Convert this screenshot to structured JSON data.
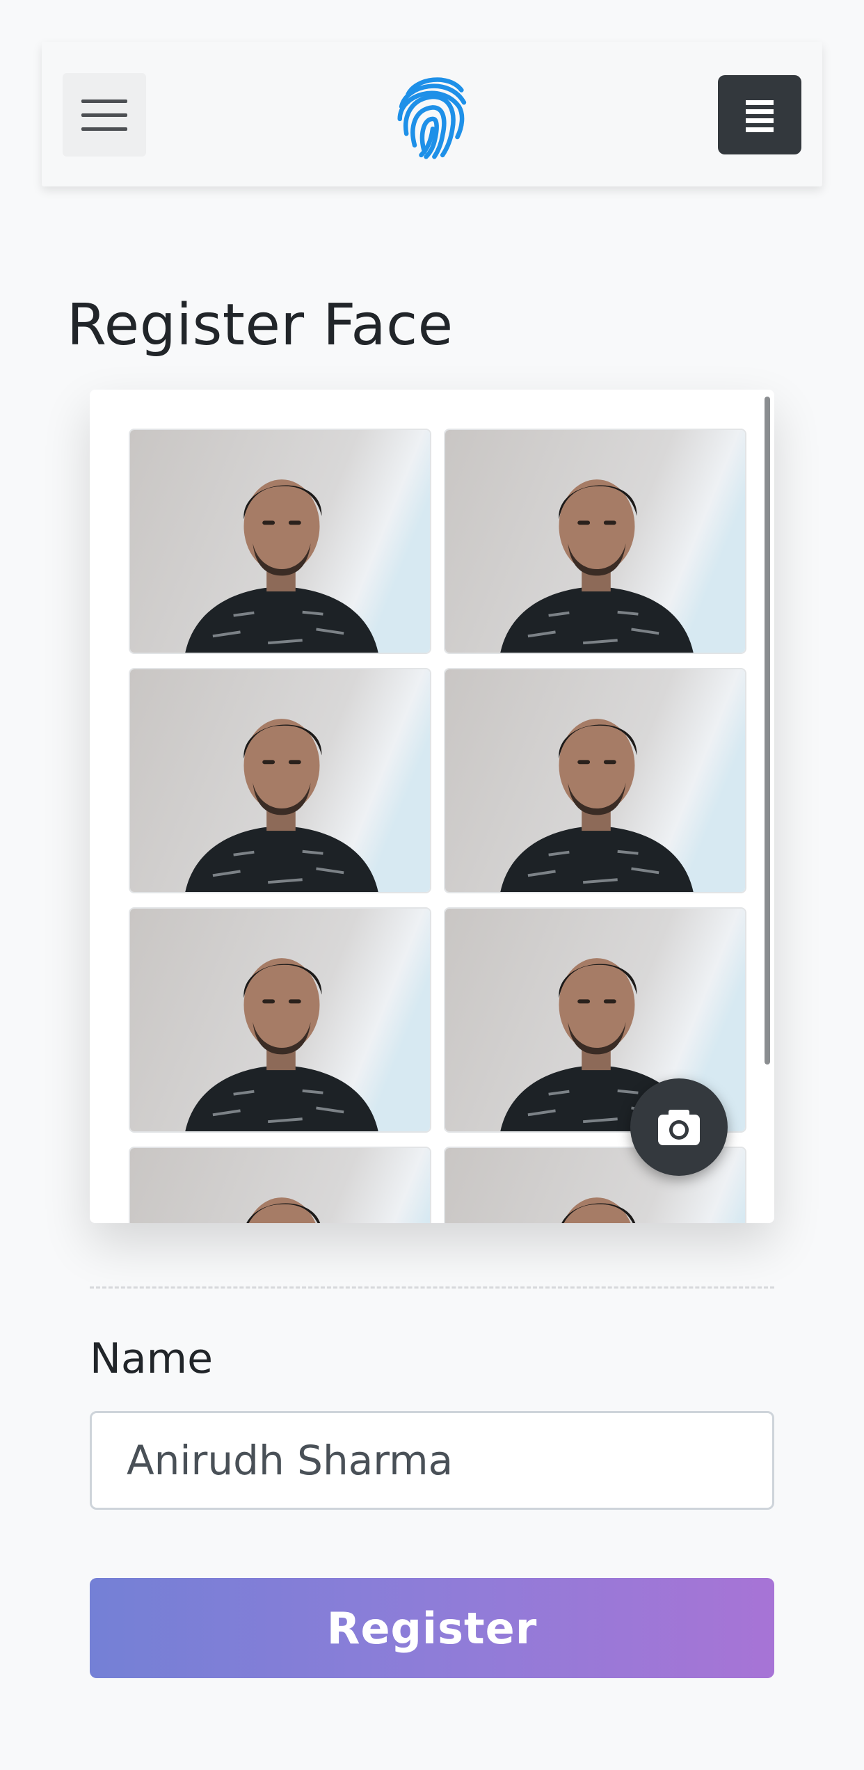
{
  "header": {
    "menu_toggle_icon": "hamburger-icon",
    "logo_icon": "fingerprint-icon",
    "options_icon": "list-icon"
  },
  "page": {
    "title": "Register Face"
  },
  "gallery": {
    "photos": [
      {
        "alt": "captured face 1"
      },
      {
        "alt": "captured face 2"
      },
      {
        "alt": "captured face 3"
      },
      {
        "alt": "captured face 4"
      },
      {
        "alt": "captured face 5"
      },
      {
        "alt": "captured face 6"
      },
      {
        "alt": "captured face 7"
      },
      {
        "alt": "captured face 8"
      }
    ],
    "capture_icon": "camera-icon"
  },
  "form": {
    "name_label": "Name",
    "name_value": "Anirudh Sharma",
    "submit_label": "Register"
  },
  "colors": {
    "accent_start": "#7480d6",
    "accent_end": "#a774d6",
    "logo": "#1e90e8",
    "dark_button": "#33383d"
  }
}
